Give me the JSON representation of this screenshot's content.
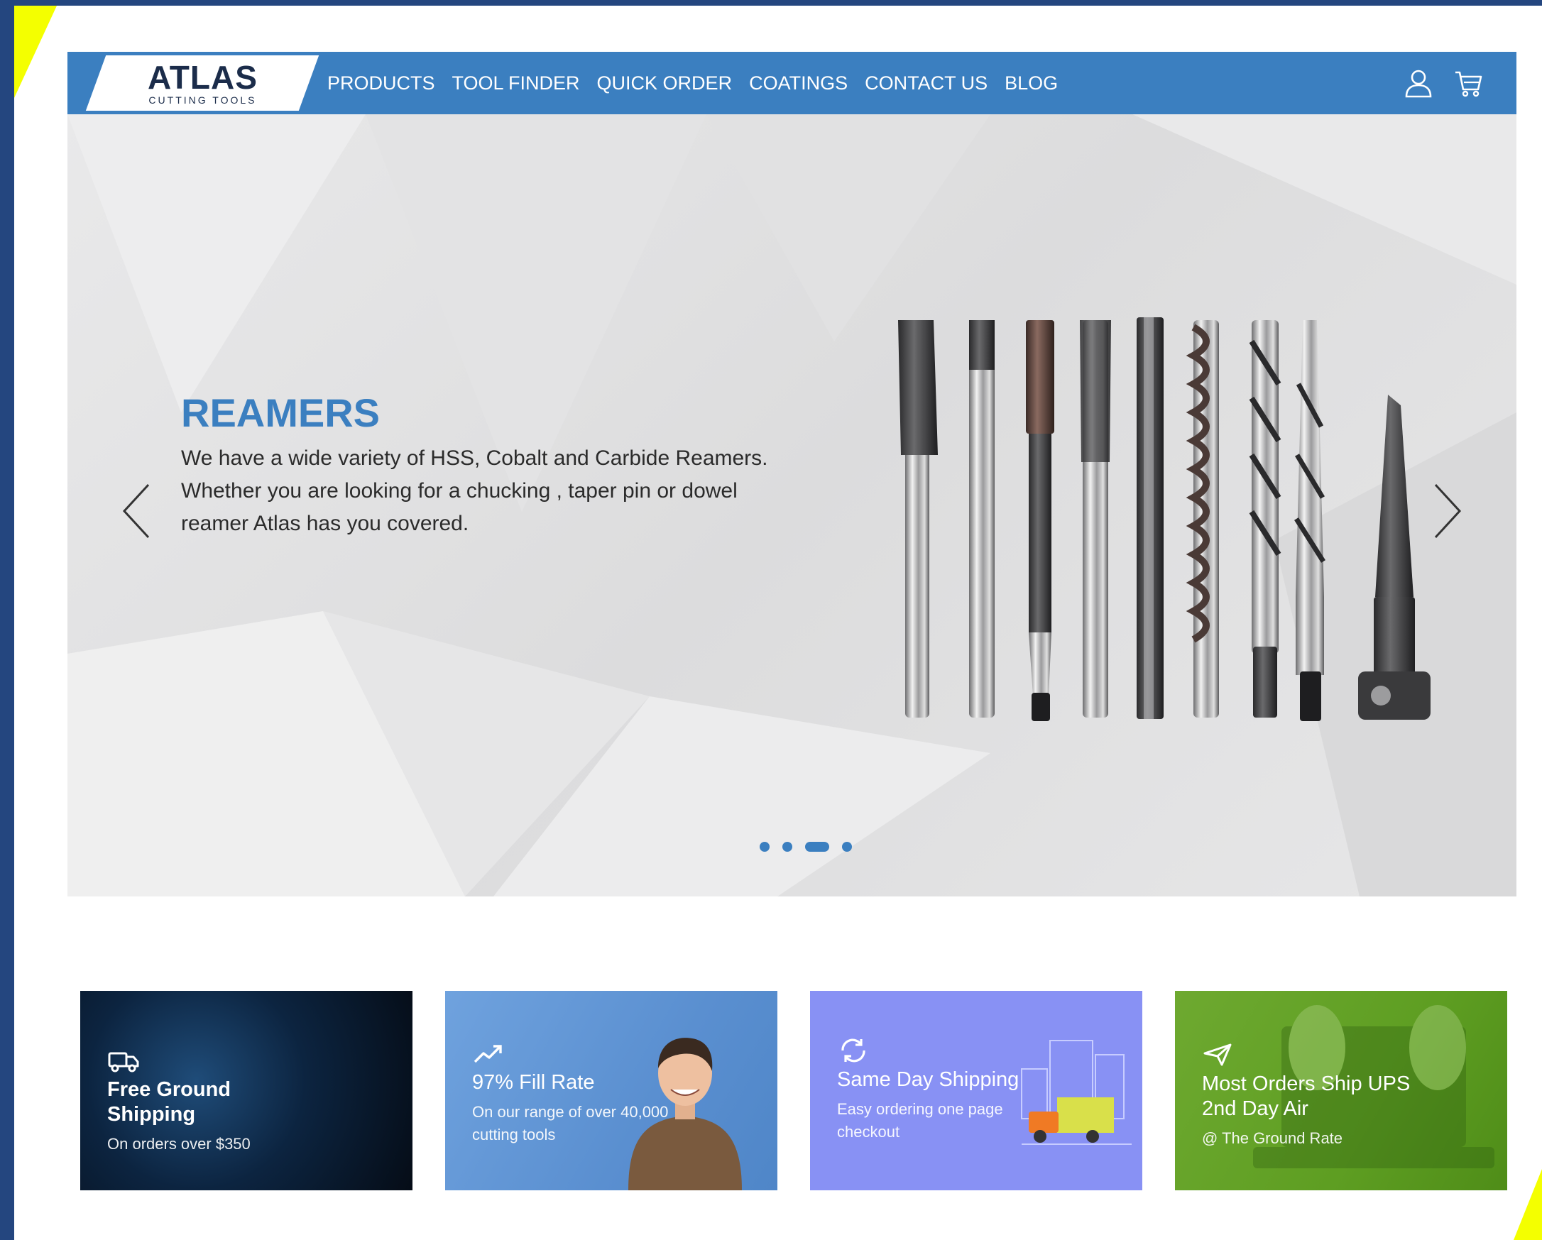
{
  "colors": {
    "brand_blue": "#3b7fc0",
    "frame_navy": "#24467f",
    "accent_yellow": "#f4ff00",
    "card_dark": "#0c2440",
    "card_sky": "#5a8fd0",
    "card_violet": "#8891f4",
    "card_green": "#5e9e22"
  },
  "logo": {
    "main": "ATLAS",
    "sub": "CUTTING TOOLS"
  },
  "nav": {
    "links": [
      "PRODUCTS",
      "TOOL FINDER",
      "QUICK ORDER",
      "COATINGS",
      "CONTACT US",
      "BLOG"
    ],
    "icons": [
      "user-icon",
      "cart-icon"
    ]
  },
  "hero": {
    "title": "REAMERS",
    "description": "We have a wide variety of HSS, Cobalt and Carbide Reamers. Whether you are looking for a chucking , taper pin or dowel reamer Atlas has you covered.",
    "slides_total": 4,
    "active_slide": 3,
    "prev_icon": "chevron-left-icon",
    "next_icon": "chevron-right-icon"
  },
  "cards": [
    {
      "icon": "truck-icon",
      "title": "Free Ground Shipping",
      "sub": "On orders over $350"
    },
    {
      "icon": "trending-up-icon",
      "title": "97% Fill Rate",
      "sub": "On our range of over 40,000 cutting tools"
    },
    {
      "icon": "refresh-icon",
      "title": "Same Day Shipping",
      "sub": "Easy ordering one page checkout"
    },
    {
      "icon": "send-icon",
      "title": "Most Orders Ship UPS 2nd Day Air",
      "sub": "@ The Ground Rate"
    }
  ]
}
